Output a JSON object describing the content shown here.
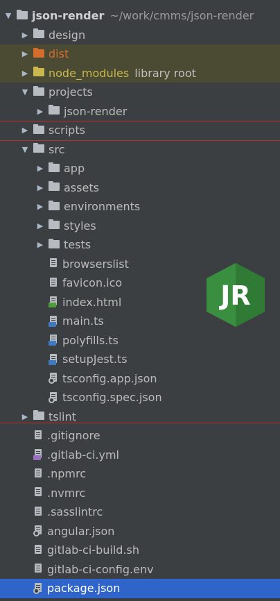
{
  "project_root": {
    "name": "json-render",
    "path": "~/work/cmms/json-render"
  },
  "tree": [
    {
      "label": "design",
      "depth": 1,
      "kind": "folder",
      "arrow": "collapsed"
    },
    {
      "label": "dist",
      "depth": 1,
      "kind": "folder",
      "arrow": "collapsed",
      "style": "excluded-orange"
    },
    {
      "label": "node_modules",
      "hint": "library root",
      "depth": 1,
      "kind": "folder",
      "arrow": "collapsed",
      "style": "excluded-olive"
    },
    {
      "label": "projects",
      "depth": 1,
      "kind": "folder",
      "arrow": "expanded"
    },
    {
      "label": "json-render",
      "depth": 2,
      "kind": "folder",
      "arrow": "collapsed"
    },
    {
      "label": "scripts",
      "depth": 1,
      "kind": "folder",
      "arrow": "collapsed"
    },
    {
      "label": "src",
      "depth": 1,
      "kind": "folder",
      "arrow": "expanded"
    },
    {
      "label": "app",
      "depth": 2,
      "kind": "folder",
      "arrow": "collapsed"
    },
    {
      "label": "assets",
      "depth": 2,
      "kind": "folder",
      "arrow": "collapsed"
    },
    {
      "label": "environments",
      "depth": 2,
      "kind": "folder",
      "arrow": "collapsed"
    },
    {
      "label": "styles",
      "depth": 2,
      "kind": "folder",
      "arrow": "collapsed"
    },
    {
      "label": "tests",
      "depth": 2,
      "kind": "folder",
      "arrow": "collapsed"
    },
    {
      "label": "browserslist",
      "depth": 2,
      "kind": "text"
    },
    {
      "label": "favicon.ico",
      "depth": 2,
      "kind": "image"
    },
    {
      "label": "index.html",
      "depth": 2,
      "kind": "html"
    },
    {
      "label": "main.ts",
      "depth": 2,
      "kind": "ts"
    },
    {
      "label": "polyfills.ts",
      "depth": 2,
      "kind": "ts"
    },
    {
      "label": "setupJest.ts",
      "depth": 2,
      "kind": "ts"
    },
    {
      "label": "tsconfig.app.json",
      "depth": 2,
      "kind": "config"
    },
    {
      "label": "tsconfig.spec.json",
      "depth": 2,
      "kind": "config"
    },
    {
      "label": "tslint",
      "depth": 1,
      "kind": "folder",
      "arrow": "collapsed"
    },
    {
      "label": ".gitignore",
      "depth": 1,
      "kind": "text"
    },
    {
      "label": ".gitlab-ci.yml",
      "depth": 1,
      "kind": "yml"
    },
    {
      "label": ".npmrc",
      "depth": 1,
      "kind": "text"
    },
    {
      "label": ".nvmrc",
      "depth": 1,
      "kind": "text"
    },
    {
      "label": ".sasslintrc",
      "depth": 1,
      "kind": "text"
    },
    {
      "label": "angular.json",
      "depth": 1,
      "kind": "config"
    },
    {
      "label": "gitlab-ci-build.sh",
      "depth": 1,
      "kind": "text"
    },
    {
      "label": "gitlab-ci-config.env",
      "depth": 1,
      "kind": "text"
    },
    {
      "label": "package.json",
      "depth": 1,
      "kind": "config",
      "selected": true
    }
  ],
  "logo": {
    "text": "JR",
    "color": "#3a8e3f"
  },
  "colors": {
    "background": "#3c3f41",
    "selection": "#2f65ca",
    "excluded_bg": "#4b4a32",
    "divider_red": "#b8302f"
  }
}
